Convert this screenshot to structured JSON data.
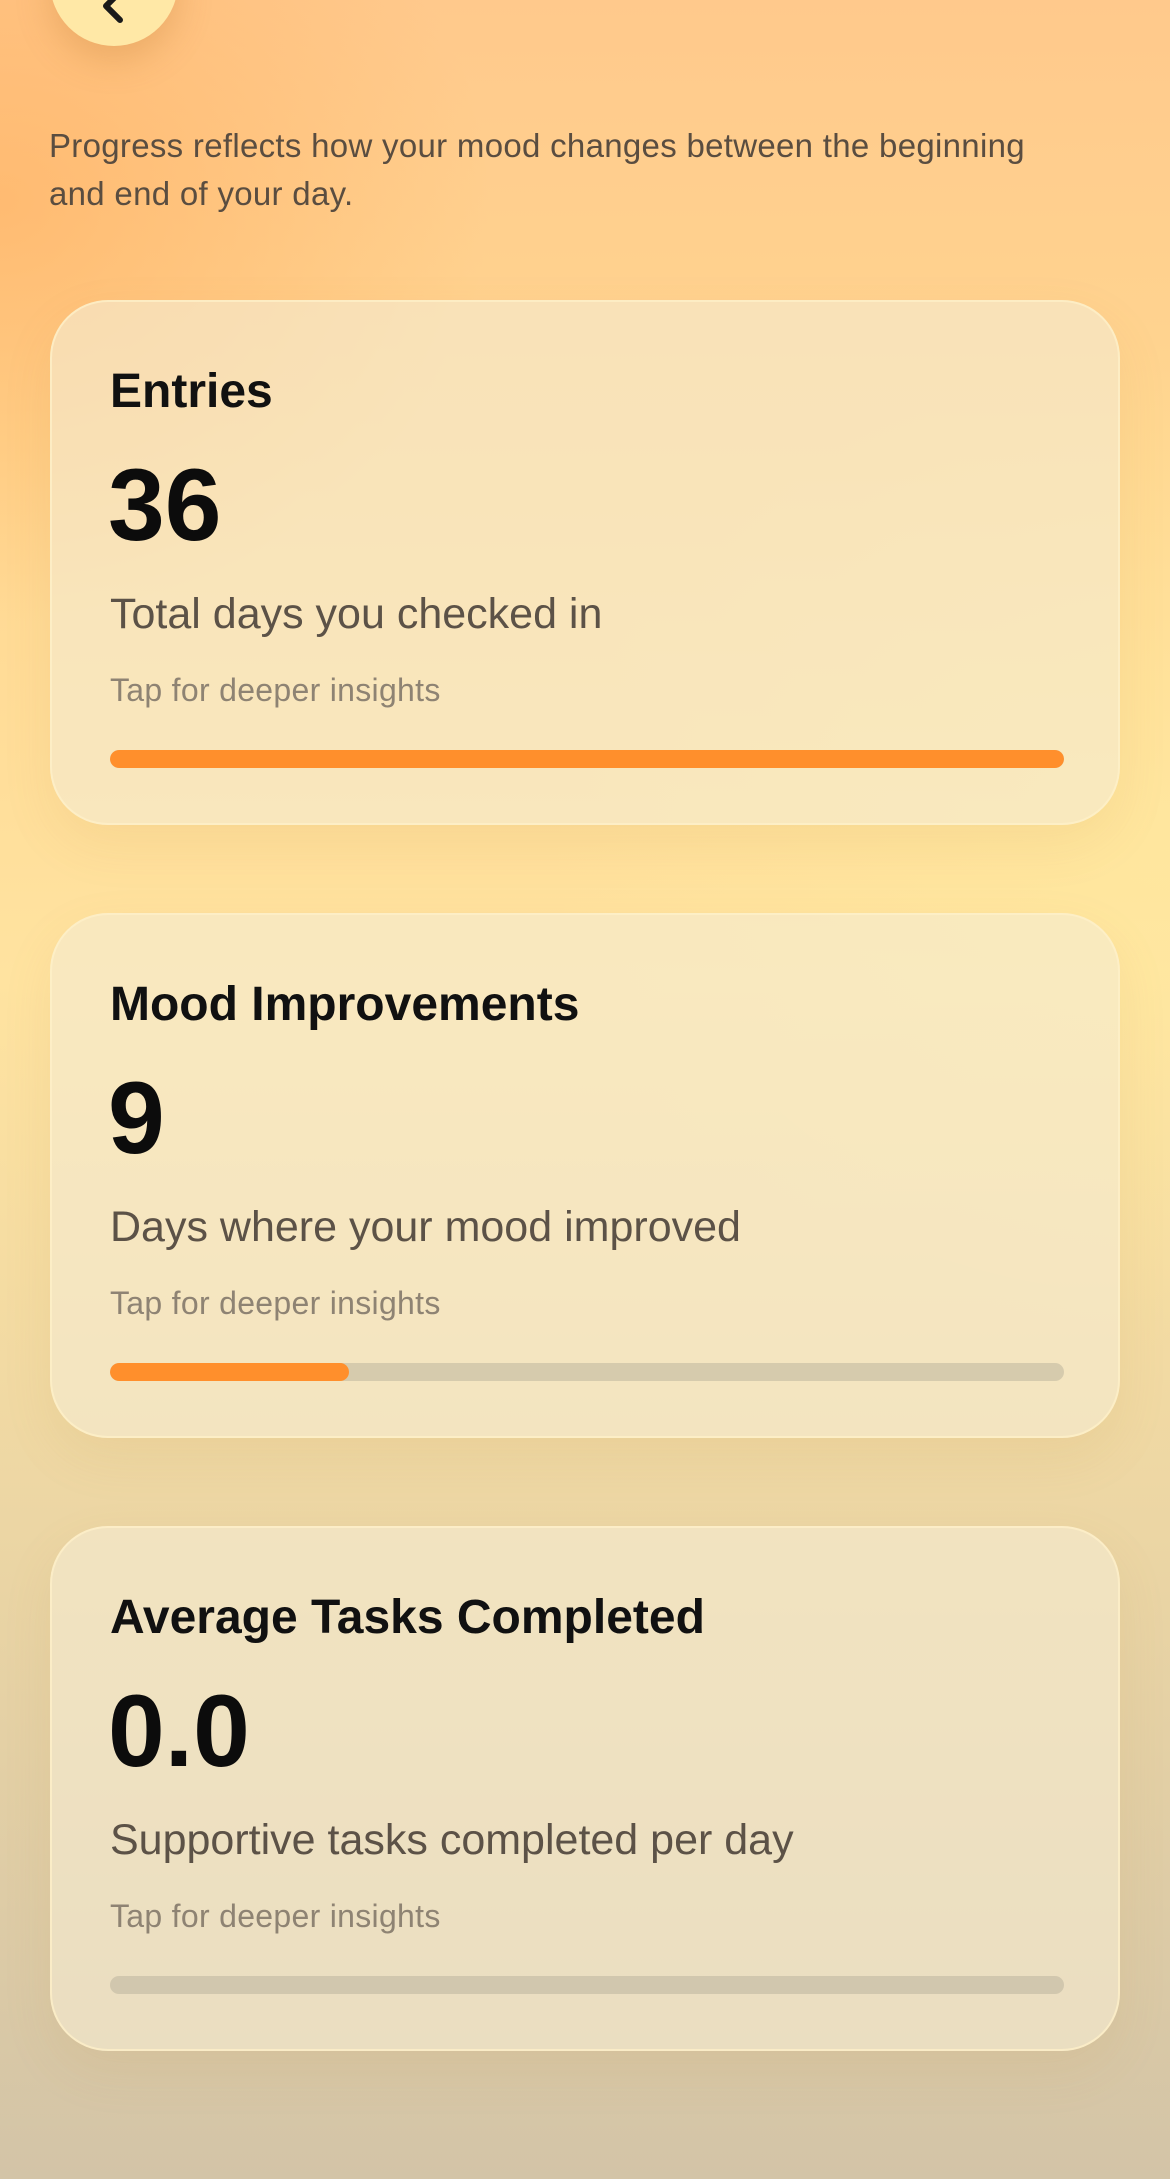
{
  "intro": "Progress reflects how your mood changes between the beginning and end of your day.",
  "accent_color": "#ff8f2c",
  "back_icon": "chevron-left-icon",
  "cards": [
    {
      "title": "Entries",
      "value": "36",
      "description": "Total days you checked in",
      "hint": "Tap for deeper insights",
      "progress": 1.0
    },
    {
      "title": "Mood Improvements",
      "value": "9",
      "description": "Days where your mood improved",
      "hint": "Tap for deeper insights",
      "progress": 0.25
    },
    {
      "title": "Average Tasks Completed",
      "value": "0.0",
      "description": "Supportive tasks completed per day",
      "hint": "Tap for deeper insights",
      "progress": 0.0
    }
  ]
}
